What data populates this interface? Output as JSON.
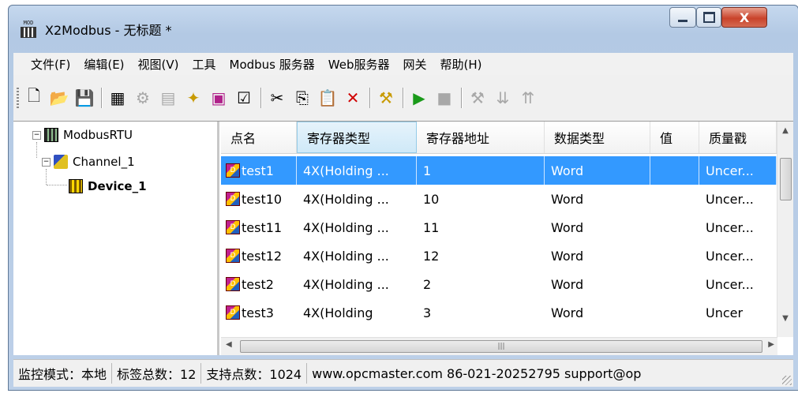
{
  "window": {
    "title": "X2Modbus - 无标题 *",
    "app_icon_text": "MOD",
    "close_glyph": "X"
  },
  "menu": [
    "文件(F)",
    "编辑(E)",
    "视图(V)",
    "工具",
    "Modbus 服务器",
    "Web服务器",
    "网关",
    "帮助(H)"
  ],
  "toolbar": {
    "groups": [
      [
        "new-icon",
        "open-icon",
        "save-icon"
      ],
      [
        "add-channel-icon",
        "add-device-icon",
        "add-group-icon",
        "add-tag-icon",
        "tag-icon",
        "properties-icon"
      ],
      [
        "cut-icon",
        "copy-icon",
        "paste-icon",
        "delete-icon"
      ],
      [
        "settings-icon"
      ],
      [
        "run-icon",
        "stop-icon"
      ],
      [
        "tools-icon",
        "load-icon",
        "upload-icon"
      ]
    ]
  },
  "tree": {
    "root": "ModbusRTU",
    "channel": "Channel_1",
    "device": "Device_1"
  },
  "table": {
    "columns": [
      "点名",
      "寄存器类型",
      "寄存器地址",
      "数据类型",
      "值",
      "质量戳"
    ],
    "sorted_column": 1,
    "selected_row": 0,
    "rows": [
      [
        "test1",
        "4X(Holding ...",
        "1",
        "Word",
        "",
        "Uncer..."
      ],
      [
        "test10",
        "4X(Holding ...",
        "10",
        "Word",
        "",
        "Uncer..."
      ],
      [
        "test11",
        "4X(Holding ...",
        "11",
        "Word",
        "",
        "Uncer..."
      ],
      [
        "test12",
        "4X(Holding ...",
        "12",
        "Word",
        "",
        "Uncer..."
      ],
      [
        "test2",
        "4X(Holding ...",
        "2",
        "Word",
        "",
        "Uncer..."
      ],
      [
        "test3",
        "4X(Holding",
        "3",
        "Word",
        "",
        "Uncer"
      ]
    ]
  },
  "status": {
    "mode": "监控模式：本地",
    "tag_count": "标签总数：12",
    "supported": "支持点数：1024",
    "contact": "www.opcmaster.com 86-021-20252795 support@op"
  },
  "colors": {
    "selection": "#3399ff",
    "title_gradient_top": "#c5d8ee",
    "close_button": "#c9432b"
  }
}
